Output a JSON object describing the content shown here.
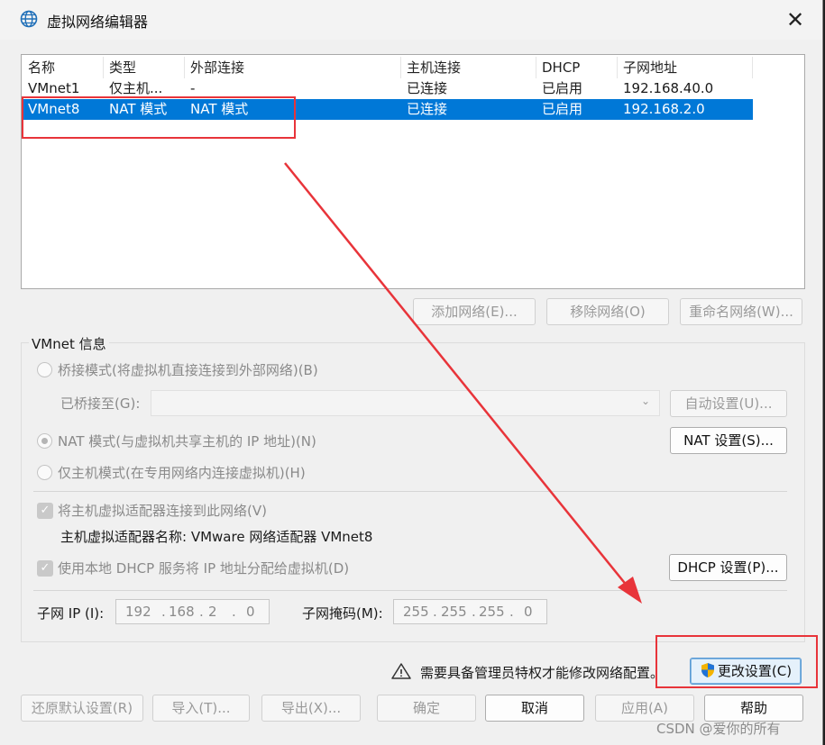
{
  "window": {
    "title": "虚拟网络编辑器",
    "close_icon": "✕"
  },
  "table": {
    "headers": [
      "名称",
      "类型",
      "外部连接",
      "主机连接",
      "DHCP",
      "子网地址"
    ],
    "rows": [
      [
        "VMnet1",
        "仅主机...",
        "-",
        "已连接",
        "已启用",
        "192.168.40.0"
      ],
      [
        "VMnet8",
        "NAT 模式",
        "NAT 模式",
        "已连接",
        "已启用",
        "192.168.2.0"
      ]
    ],
    "selected_row": 1
  },
  "list_buttons": {
    "add": "添加网络(E)...",
    "remove": "移除网络(O)",
    "rename": "重命名网络(W)..."
  },
  "vmnet_info": {
    "legend": "VMnet 信息",
    "bridge_radio": "桥接模式(将虚拟机直接连接到外部网络)(B)",
    "bridged_to_label": "已桥接至(G):",
    "bridged_to_value": "",
    "auto_button": "自动设置(U)...",
    "nat_radio": "NAT 模式(与虚拟机共享主机的 IP 地址)(N)",
    "nat_button": "NAT 设置(S)...",
    "hostonly_radio": "仅主机模式(在专用网络内连接虚拟机)(H)",
    "connect_adapter": "将主机虚拟适配器连接到此网络(V)",
    "adapter_name": "主机虚拟适配器名称: VMware 网络适配器 VMnet8",
    "use_dhcp": "使用本地 DHCP 服务将 IP 地址分配给虚拟机(D)",
    "dhcp_button": "DHCP 设置(P)...",
    "subnet_ip_label": "子网 IP (I):",
    "subnet_ip": [
      "192",
      "168",
      "2",
      "0"
    ],
    "subnet_mask_label": "子网掩码(M):",
    "subnet_mask": [
      "255",
      "255",
      "255",
      "0"
    ],
    "dot": "."
  },
  "admin": {
    "warning": "需要具备管理员特权才能修改网络配置。",
    "change_button": "更改设置(C)"
  },
  "footer": {
    "restore": "还原默认设置(R)",
    "import": "导入(T)...",
    "export": "导出(X)...",
    "ok": "确定",
    "cancel": "取消",
    "apply": "应用(A)",
    "help": "帮助"
  },
  "watermark": "CSDN @爱你的所有",
  "colors": {
    "selection": "#0078d7",
    "annotation": "#e8343a"
  }
}
